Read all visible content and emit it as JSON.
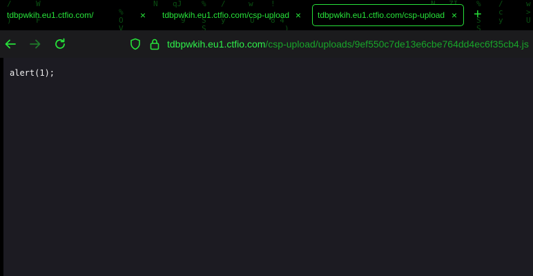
{
  "tabs": [
    {
      "title": "tdbpwkih.eu1.ctfio.com/",
      "active": false
    },
    {
      "title": "tdbpwkih.eu1.ctfio.com/csp-upload",
      "active": false
    },
    {
      "title": "tdbpwkih.eu1.ctfio.com/csp-upload",
      "active": true
    }
  ],
  "tab_close_glyph": "×",
  "new_tab_glyph": "+",
  "address": {
    "domain": "tdbpwkih.eu1.ctfio.com",
    "path": "/csp-upload/uploads/9ef550c7de13e6cbe764dd4ec6f35cb4.js"
  },
  "icons": {
    "back": "arrow-left-icon",
    "forward": "arrow-right-icon",
    "reload": "reload-icon",
    "shield": "shield-icon",
    "lock": "lock-icon"
  },
  "page": {
    "code": "alert(1);"
  },
  "colors": {
    "accent": "#27e33a",
    "url_path": "#18a62a",
    "toolbar_bg": "#1b1b1d",
    "content_bg": "#1c1b22"
  }
}
